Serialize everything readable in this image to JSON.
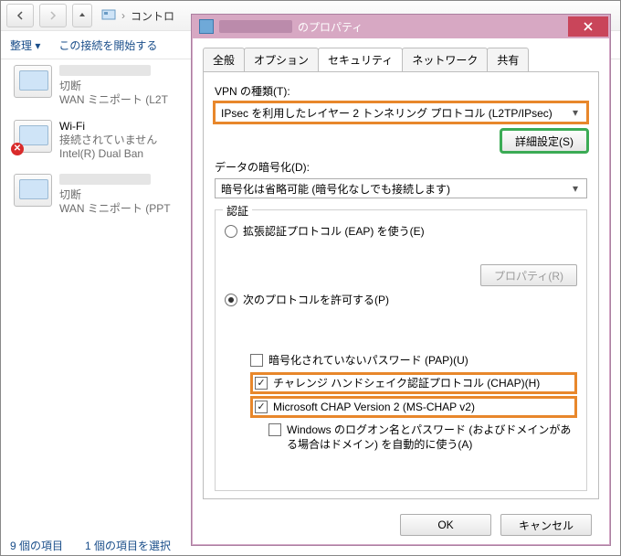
{
  "explorer": {
    "path_label": "コントロ",
    "cmd": {
      "organize": "整理",
      "start_conn": "この接続を開始する"
    },
    "connections": [
      {
        "status": "切断",
        "detail": "WAN ミニポート (L2T",
        "hasX": false
      },
      {
        "name": "Wi-Fi",
        "status": "接続されていません",
        "detail": "Intel(R) Dual Ban",
        "hasX": true
      },
      {
        "status": "切断",
        "detail": "WAN ミニポート (PPT",
        "hasX": false
      }
    ],
    "status": "9 個の項目　　1 個の項目を選択"
  },
  "dialog": {
    "title_suffix": "のプロパティ",
    "tabs": [
      "全般",
      "オプション",
      "セキュリティ",
      "ネットワーク",
      "共有"
    ],
    "active_tab": 2,
    "vpn_type_label": "VPN の種類(T):",
    "vpn_type_value": "IPsec を利用したレイヤー 2 トンネリング プロトコル (L2TP/IPsec)",
    "advanced_button": "詳細設定(S)",
    "encryption_label": "データの暗号化(D):",
    "encryption_value": "暗号化は省略可能 (暗号化なしでも接続します)",
    "auth_legend": "認証",
    "radios": {
      "eap": "拡張認証プロトコル (EAP) を使う(E)",
      "allow": "次のプロトコルを許可する(P)"
    },
    "properties_button": "プロパティ(R)",
    "checkboxes": {
      "pap": "暗号化されていないパスワード (PAP)(U)",
      "chap": "チャレンジ ハンドシェイク認証プロトコル (CHAP)(H)",
      "mschap": "Microsoft CHAP Version 2 (MS-CHAP v2)",
      "winlogon": "Windows のログオン名とパスワード (およびドメインがある場合はドメイン) を自動的に使う(A)"
    },
    "ok": "OK",
    "cancel": "キャンセル"
  }
}
